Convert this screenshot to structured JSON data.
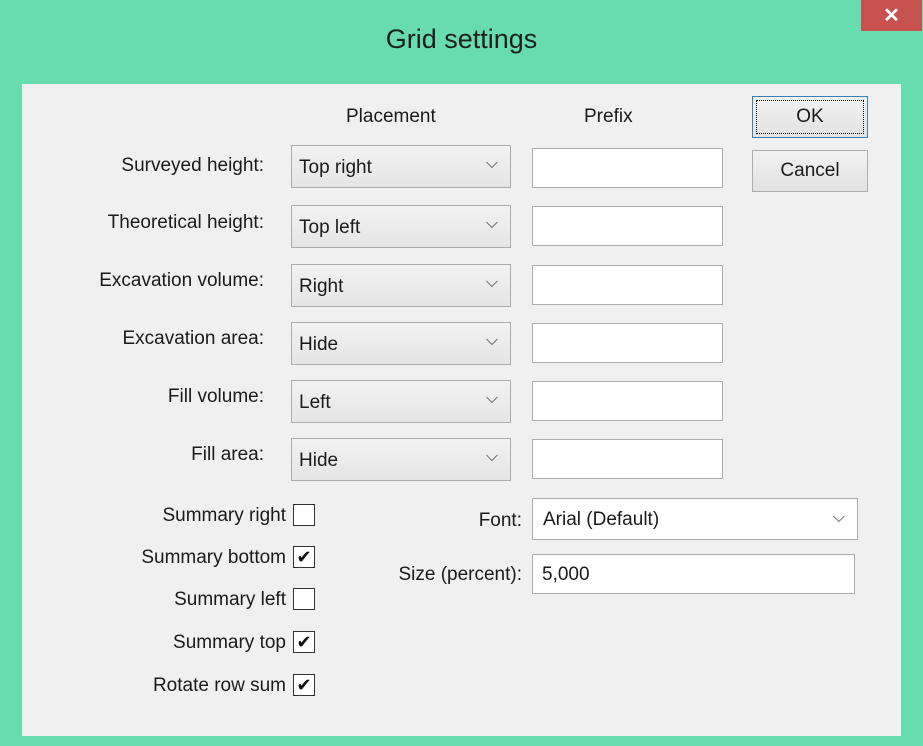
{
  "window": {
    "title": "Grid settings",
    "close_glyph": "✕"
  },
  "headers": {
    "placement": "Placement",
    "prefix": "Prefix"
  },
  "rows": [
    {
      "label": "Surveyed height:",
      "placement": "Top right",
      "prefix": ""
    },
    {
      "label": "Theoretical height:",
      "placement": "Top left",
      "prefix": ""
    },
    {
      "label": "Excavation volume:",
      "placement": "Right",
      "prefix": ""
    },
    {
      "label": "Excavation area:",
      "placement": "Hide",
      "prefix": ""
    },
    {
      "label": "Fill volume:",
      "placement": "Left",
      "prefix": ""
    },
    {
      "label": "Fill area:",
      "placement": "Hide",
      "prefix": ""
    }
  ],
  "checkboxes": [
    {
      "label": "Summary right",
      "checked": false
    },
    {
      "label": "Summary bottom",
      "checked": true
    },
    {
      "label": "Summary left",
      "checked": false
    },
    {
      "label": "Summary top",
      "checked": true
    },
    {
      "label": "Rotate row sum",
      "checked": true
    }
  ],
  "font": {
    "label": "Font:",
    "value": "Arial (Default)"
  },
  "size": {
    "label": "Size (percent):",
    "value": "5,000"
  },
  "buttons": {
    "ok": "OK",
    "cancel": "Cancel"
  },
  "icons": {
    "dropdown": "chevron-down-icon",
    "check": "checkmark-icon",
    "close": "close-icon"
  },
  "colors": {
    "titlebar": "#67dcae",
    "close_button": "#c7514f",
    "client": "#f0f0f0"
  }
}
